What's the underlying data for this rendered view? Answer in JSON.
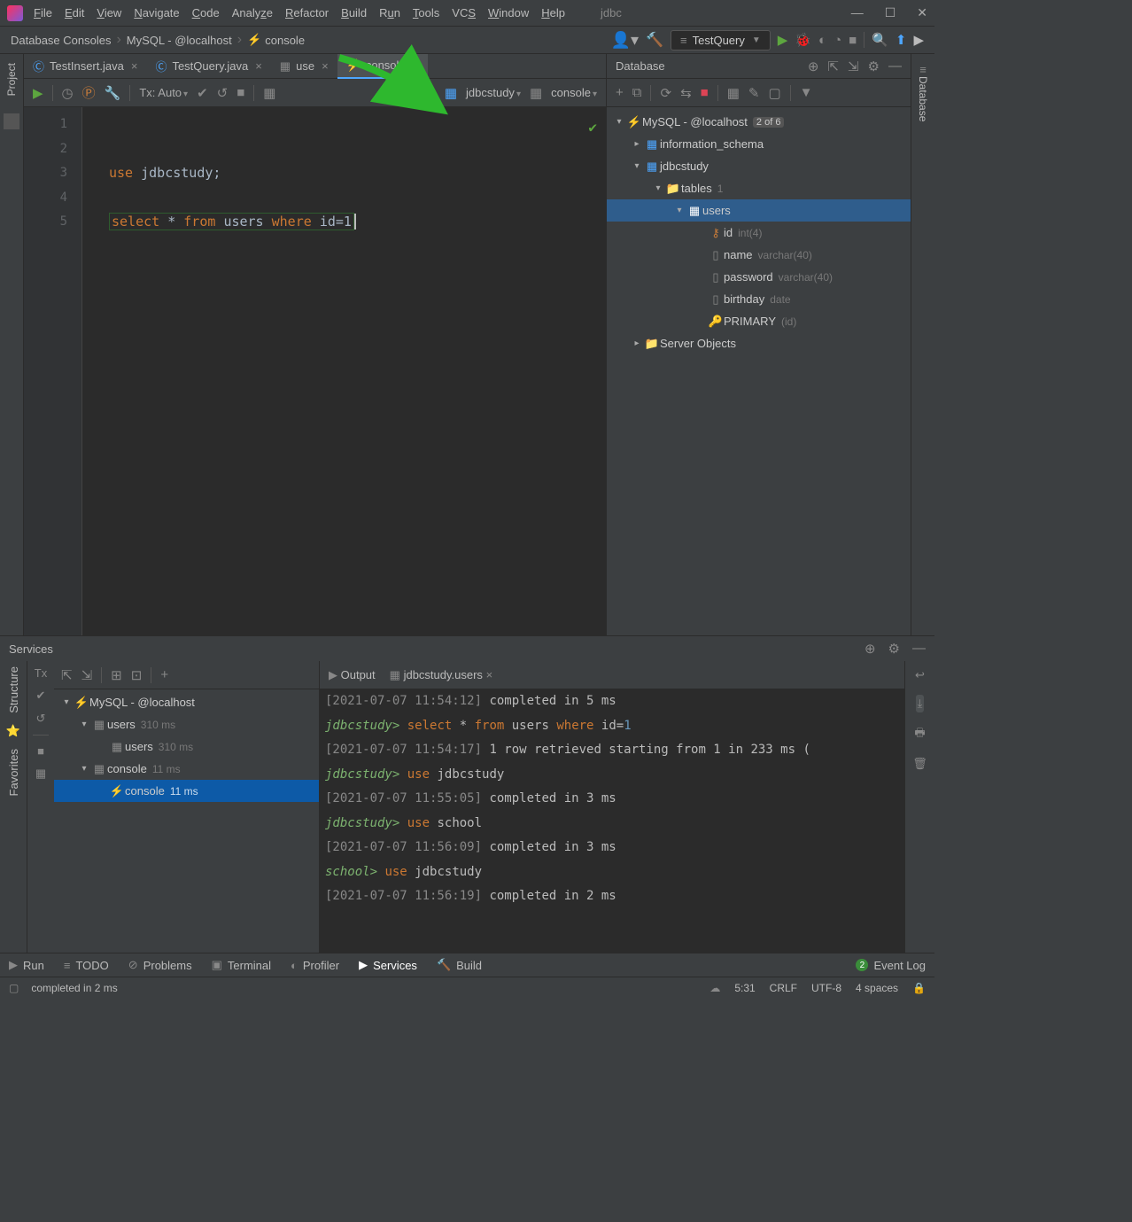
{
  "title": "jdbc",
  "menu": [
    "File",
    "Edit",
    "View",
    "Navigate",
    "Code",
    "Analyze",
    "Refactor",
    "Build",
    "Run",
    "Tools",
    "VCS",
    "Window",
    "Help"
  ],
  "breadcrumb": {
    "db": "Database Consoles",
    "conn": "MySQL - @localhost",
    "console": "console"
  },
  "runConfig": "TestQuery",
  "tabs": [
    {
      "icon": "class",
      "label": "TestInsert.java",
      "active": false
    },
    {
      "icon": "class",
      "label": "TestQuery.java",
      "active": false
    },
    {
      "icon": "table",
      "label": "use",
      "active": false
    },
    {
      "icon": "console",
      "label": "console",
      "active": true
    }
  ],
  "tx": "Tx: Auto",
  "schemaSel": "jdbcstudy",
  "consoleSel": "console",
  "gutter": [
    "1",
    "2",
    "3",
    "4",
    "5"
  ],
  "code": {
    "l3": {
      "kw": "use",
      "rest": "  jdbcstudy;"
    },
    "l5": {
      "sel": "select",
      "star": "*",
      "from": "from",
      "tbl": "users",
      "where": "where",
      "col": "id",
      "eq": "=",
      "val": "1"
    }
  },
  "dbPanel": {
    "title": "Database",
    "root": "MySQL - @localhost",
    "rootBadge": "2 of 6",
    "info": "information_schema",
    "study": "jdbcstudy",
    "tables": "tables",
    "tablesCount": "1",
    "users": "users",
    "cols": [
      {
        "name": "id",
        "type": "int(4)",
        "icon": "key-col"
      },
      {
        "name": "name",
        "type": "varchar(40)",
        "icon": "col"
      },
      {
        "name": "password",
        "type": "varchar(40)",
        "icon": "col"
      },
      {
        "name": "birthday",
        "type": "date",
        "icon": "col"
      },
      {
        "name": "PRIMARY",
        "type": "(id)",
        "icon": "key"
      }
    ],
    "server": "Server Objects"
  },
  "services": {
    "title": "Services",
    "tree": {
      "root": "MySQL - @localhost",
      "n1": "users",
      "n1t": "310 ms",
      "n1c": "users",
      "n1ct": "310 ms",
      "n2": "console",
      "n2t": "11 ms",
      "n2c": "console",
      "n2ct": "11 ms"
    },
    "outTabs": {
      "output": "Output",
      "table": "jdbcstudy.users"
    },
    "lines": [
      "[2021-07-07 11:54:12] completed in 5 ms",
      "jdbcstudy> select * from users where id=1",
      "[2021-07-07 11:54:17] 1 row retrieved starting from 1 in 233 ms (",
      "jdbcstudy> use jdbcstudy",
      "[2021-07-07 11:55:05] completed in 3 ms",
      "jdbcstudy> use school",
      "[2021-07-07 11:56:09] completed in 3 ms",
      "school> use jdbcstudy",
      "[2021-07-07 11:56:19] completed in 2 ms"
    ]
  },
  "bottomTabs": [
    "Run",
    "TODO",
    "Problems",
    "Terminal",
    "Profiler",
    "Services",
    "Build"
  ],
  "eventLog": "Event Log",
  "status": {
    "msg": "completed in 2 ms",
    "pos": "5:31",
    "crlf": "CRLF",
    "enc": "UTF-8",
    "indent": "4 spaces"
  },
  "leftRail": "Project",
  "rightRail": "Database",
  "leftRail2a": "Structure",
  "leftRail2b": "Favorites"
}
